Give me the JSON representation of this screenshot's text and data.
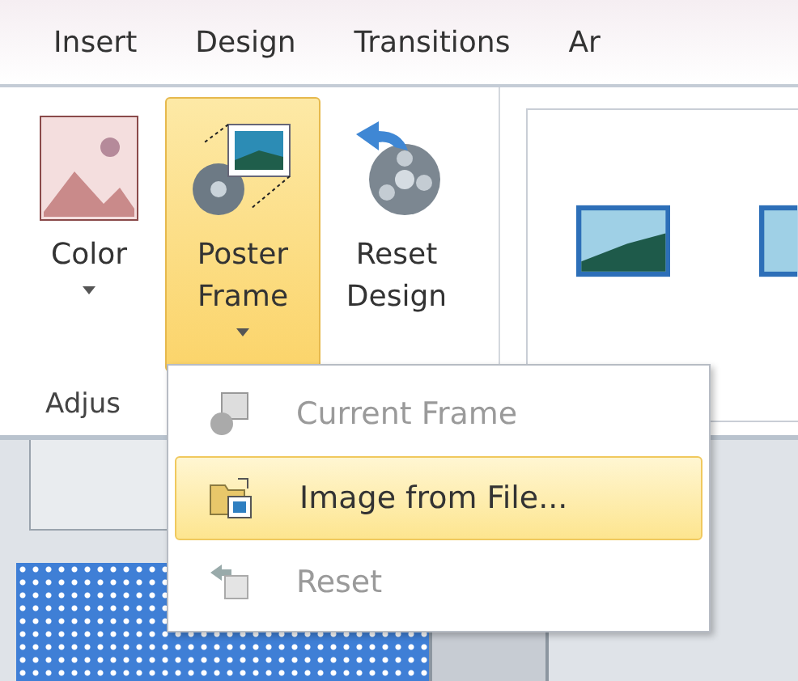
{
  "tabs": [
    {
      "label": "Insert",
      "selected": false
    },
    {
      "label": "Design",
      "selected": false
    },
    {
      "label": "Transitions",
      "selected": false
    },
    {
      "label": "Ar",
      "selected": false
    }
  ],
  "ribbon": {
    "buttons": [
      {
        "kind": "color",
        "label": "Color",
        "dropdown": true,
        "selected": false
      },
      {
        "kind": "poster",
        "label": "Poster Frame",
        "dropdown": true,
        "selected": true
      },
      {
        "kind": "reset",
        "label": "Reset Design",
        "dropdown": false,
        "selected": false
      }
    ],
    "group_label": "Adjus"
  },
  "menu": {
    "items": [
      {
        "kind": "frame",
        "label": "Current Frame",
        "disabled": true,
        "selected": false
      },
      {
        "kind": "file",
        "label": "Image from File...",
        "disabled": false,
        "selected": true
      },
      {
        "kind": "reset",
        "label": "Reset",
        "disabled": true,
        "selected": false
      }
    ]
  }
}
